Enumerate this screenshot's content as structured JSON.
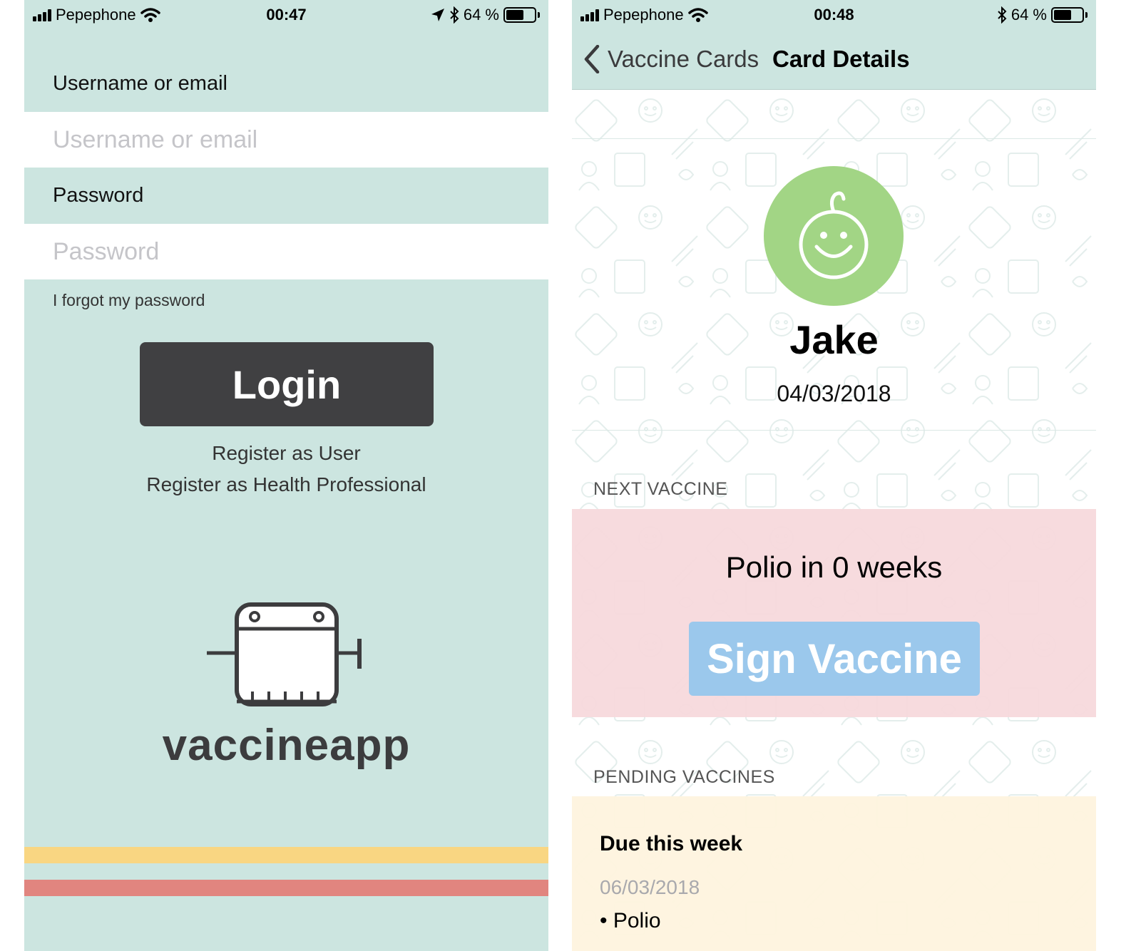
{
  "login_screen": {
    "status_bar": {
      "carrier": "Pepephone",
      "time": "00:47",
      "battery_text": "64 %",
      "battery_level": 0.64
    },
    "username_label": "Username or email",
    "username_placeholder": "Username or email",
    "password_label": "Password",
    "password_placeholder": "Password",
    "forgot_password": "I forgot my password",
    "login_button": "Login",
    "register_user": "Register as User",
    "register_professional": "Register as Health Professional",
    "logo_text": "vaccineapp",
    "stripe_colors": [
      "#f9d682",
      "#e1857f"
    ]
  },
  "card_details_screen": {
    "status_bar": {
      "carrier": "Pepephone",
      "time": "00:48",
      "battery_text": "64 %",
      "battery_level": 0.64
    },
    "nav": {
      "back_label": "Vaccine Cards",
      "title": "Card Details"
    },
    "child": {
      "name": "Jake",
      "birth_date": "04/03/2018",
      "avatar_color": "#a2d585"
    },
    "next_vaccine": {
      "header": "NEXT VACCINE",
      "text": "Polio in 0 weeks",
      "sign_button": "Sign Vaccine",
      "panel_color": "#f7d9dc",
      "button_color": "#9bc8ec"
    },
    "pending_vaccines": {
      "header": "PENDING VACCINES",
      "group_title": "Due this week",
      "date": "06/03/2018",
      "items": [
        "Polio"
      ],
      "panel_color": "#fef3de"
    }
  }
}
